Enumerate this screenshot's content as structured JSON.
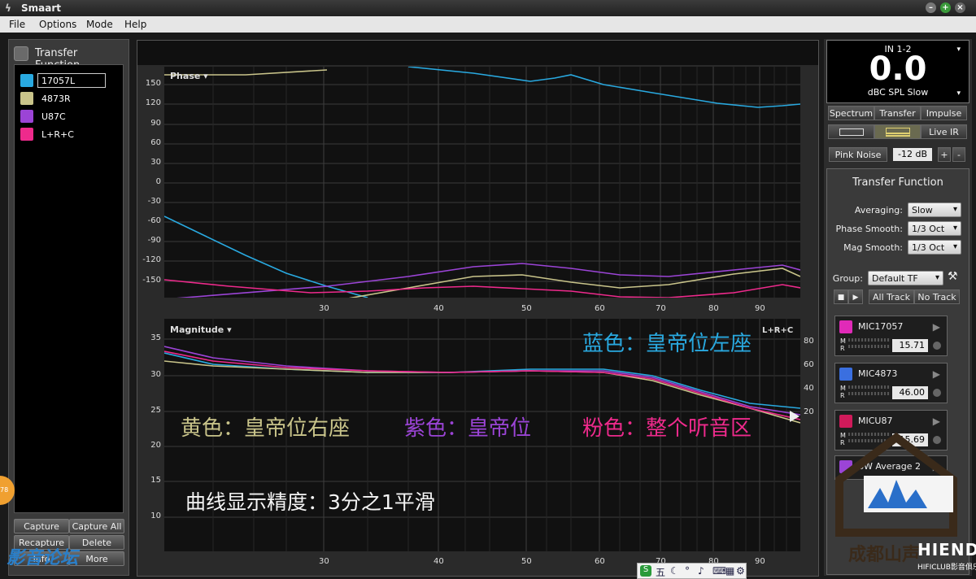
{
  "app": {
    "title": "Smaart"
  },
  "menu": [
    "File",
    "Options",
    "Mode",
    "Help"
  ],
  "left_panel": {
    "header": "Transfer Function",
    "tracks": [
      {
        "label": "17057L",
        "color": "#29a9e0"
      },
      {
        "label": "4873R",
        "color": "#c9c48a"
      },
      {
        "label": "U87C",
        "color": "#9b44d6"
      },
      {
        "label": "L+R+C",
        "color": "#ee2a8c"
      }
    ],
    "buttons": {
      "capture": "Capture",
      "capture_all": "Capture All",
      "recapture": "Recapture",
      "delete": "Delete",
      "info": "Info",
      "more": "More"
    },
    "badge": "78"
  },
  "phase_plot": {
    "title": "Phase ▾",
    "yticks": [
      "150",
      "120",
      "90",
      "60",
      "30",
      "0",
      "-30",
      "-60",
      "-90",
      "-120",
      "-150"
    ],
    "xticks": [
      "30",
      "40",
      "50",
      "60",
      "70",
      "80",
      "90"
    ]
  },
  "magnitude_plot": {
    "title": "Magnitude ▾",
    "yticks": [
      "35",
      "30",
      "25",
      "20",
      "15",
      "10"
    ],
    "yticks_right": [
      "80",
      "60",
      "40",
      "20"
    ],
    "xticks": [
      "30",
      "40",
      "50",
      "60",
      "70",
      "80",
      "90"
    ],
    "corner_label": "L+R+C"
  },
  "annotations": {
    "blue": "蓝色：皇帝位左座",
    "yellow": "黄色：皇帝位右座",
    "purple": "紫色：皇帝位",
    "pink": "粉色：整个听音区",
    "precision": "曲线显示精度：3分之1平滑"
  },
  "meter": {
    "channel": "IN 1-2",
    "value": "0.0",
    "unit": "dBC SPL Slow"
  },
  "mode_buttons": [
    "Spectrum",
    "Transfer",
    "Impulse"
  ],
  "live_ir": "Live IR",
  "pink_noise": {
    "label": "Pink Noise",
    "level": "-12 dB",
    "plus": "+",
    "minus": "-"
  },
  "tf_settings": {
    "title": "Transfer Function",
    "averaging_label": "Averaging:",
    "averaging": "Slow",
    "phase_smooth_label": "Phase Smooth:",
    "phase_smooth": "1/3 Oct",
    "mag_smooth_label": "Mag Smooth:",
    "mag_smooth": "1/3 Oct",
    "group_label": "Group:",
    "group": "Default TF",
    "all_track": "All Track",
    "no_track": "No Track"
  },
  "mics": [
    {
      "name": "MIC17057",
      "value": "15.71",
      "color": "#e02ab8"
    },
    {
      "name": "MIC4873",
      "value": "46.00",
      "color": "#3a6fe0"
    },
    {
      "name": "MICU87",
      "value": "15.69",
      "color": "#d01a5a"
    },
    {
      "name": "SW Average 2",
      "value": "",
      "color": "#9b44d6"
    }
  ],
  "watermarks": {
    "left": "影音论坛",
    "bottom_right": "成都山声",
    "brand": "HIENDY",
    "brand_sub": "HIFICLUB影音俱乐部"
  },
  "colors": {
    "blue": "#29a9e0",
    "yellow": "#c9c48a",
    "purple": "#9b44d6",
    "pink": "#ee2a8c"
  }
}
